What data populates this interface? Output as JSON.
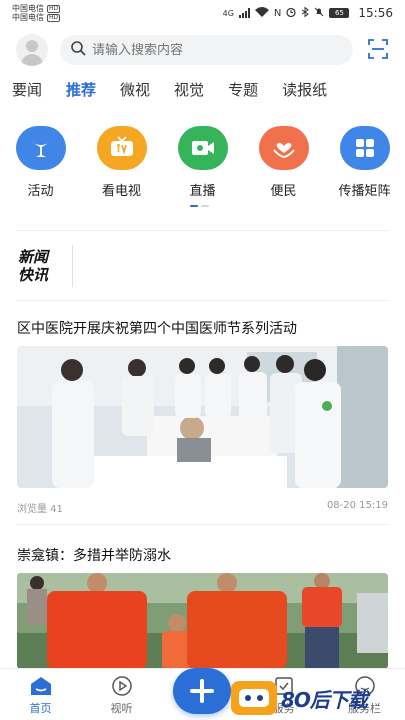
{
  "status_bar": {
    "carrier1": "中国电信",
    "carrier2": "中国电信",
    "hd": "HD",
    "net": "4G",
    "battery": "65",
    "time": "15:56"
  },
  "header": {
    "search_placeholder": "请输入搜索内容"
  },
  "tabs": [
    {
      "label": "要闻"
    },
    {
      "label": "推荐"
    },
    {
      "label": "微视"
    },
    {
      "label": "视觉"
    },
    {
      "label": "专题"
    },
    {
      "label": "读报纸"
    }
  ],
  "quick_entries": [
    {
      "label": "活动",
      "icon": "activity-icon",
      "color": "#3f86e8"
    },
    {
      "label": "看电视",
      "icon": "tv-icon",
      "color": "#f5a623"
    },
    {
      "label": "直播",
      "icon": "live-camera-icon",
      "color": "#36b45c"
    },
    {
      "label": "便民",
      "icon": "convenience-icon",
      "color": "#f0714b"
    },
    {
      "label": "传播矩阵",
      "icon": "matrix-icon",
      "color": "#3f86e8"
    }
  ],
  "flash_news": {
    "logo_line1": "新闻",
    "logo_line2": "快讯"
  },
  "articles": [
    {
      "title": "区中医院开展庆祝第四个中国医师节系列活动",
      "views": "浏览量 41",
      "date": "08-20 15:19"
    },
    {
      "title": "崇龛镇：多措并举防溺水"
    }
  ],
  "bottom_nav": {
    "home": "首页",
    "listen": "视听",
    "service": "服务",
    "mine": "服务栏"
  },
  "watermark": {
    "text": "8O后下载"
  },
  "colors": {
    "accent": "#2b6fd6"
  }
}
